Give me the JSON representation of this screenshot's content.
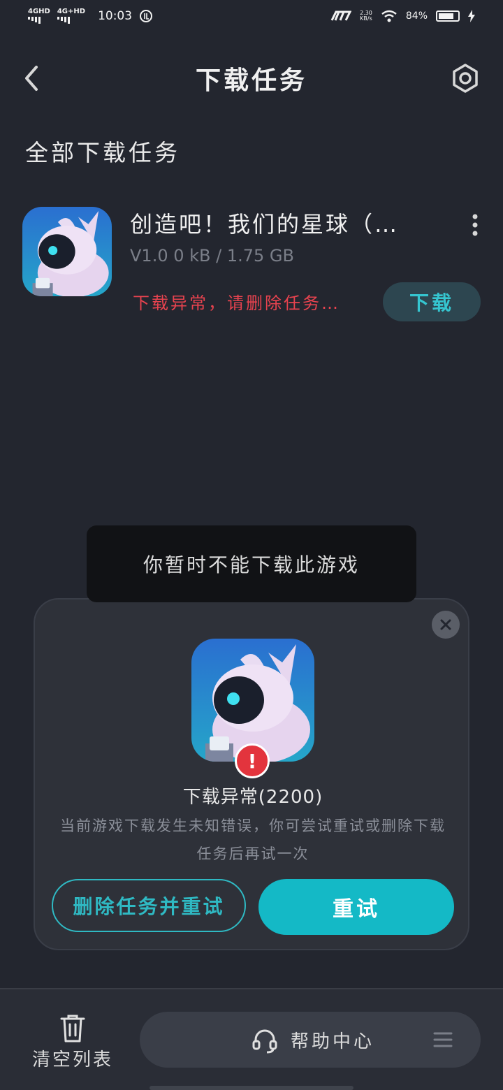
{
  "status_bar": {
    "network1": "4GHD",
    "network2": "4G+HD",
    "time": "10:03",
    "speed_value": "2.30",
    "speed_unit": "KB/s",
    "battery": "84%"
  },
  "header": {
    "title": "下载任务"
  },
  "section_title": "全部下载任务",
  "task": {
    "name": "创造吧！我们的星球（…",
    "version_size": "V1.0  0 kB / 1.75 GB",
    "error": "下载异常，请删除任务…",
    "download_label": "下载"
  },
  "toast": "你暂时不能下载此游戏",
  "dialog": {
    "badge": "!",
    "title": "下载异常(2200)",
    "description": "当前游戏下载发生未知错误，你可尝试重试或删除下载任务后再试一次",
    "delete_retry_label": "删除任务并重试",
    "retry_label": "重试"
  },
  "bottom": {
    "clear_label": "清空列表",
    "help_label": "帮助中心"
  },
  "colors": {
    "background": "#23262f",
    "accent": "#14b9c6",
    "error": "#e8434f"
  }
}
